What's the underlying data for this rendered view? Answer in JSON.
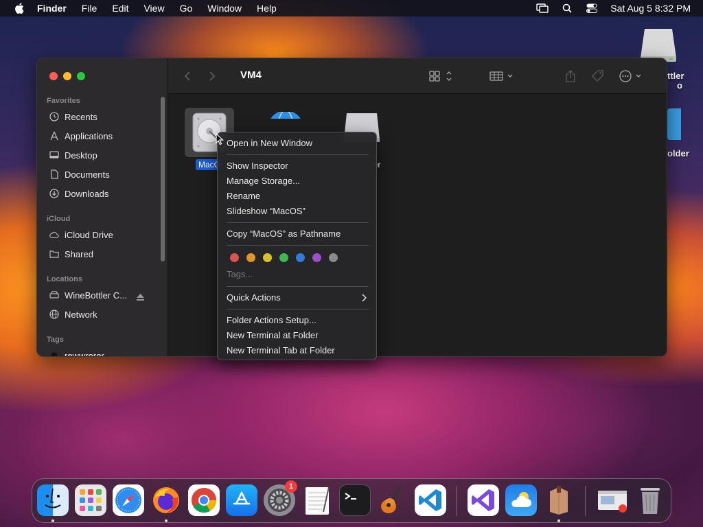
{
  "menubar": {
    "app_name": "Finder",
    "items": [
      "File",
      "Edit",
      "View",
      "Go",
      "Window",
      "Help"
    ],
    "clock": "Sat Aug 5  8:32 PM"
  },
  "desktop": {
    "icon1_label_line1": "ttler",
    "icon1_label_line2": "o",
    "icon2_label": "older"
  },
  "finder": {
    "title": "VM4",
    "sidebar": {
      "favorites_header": "Favorites",
      "favorites": [
        "Recents",
        "Applications",
        "Desktop",
        "Documents",
        "Downloads"
      ],
      "icloud_header": "iCloud",
      "icloud": [
        "iCloud Drive",
        "Shared"
      ],
      "locations_header": "Locations",
      "locations": [
        "WineBottler C...",
        "Network"
      ],
      "tags_header": "Tags",
      "tags": [
        "rewwrerer"
      ]
    },
    "files": [
      {
        "label": "MacO"
      },
      {
        "label": ""
      },
      {
        "label": "er"
      }
    ]
  },
  "context_menu": {
    "open_new_window": "Open in New Window",
    "show_inspector": "Show Inspector",
    "manage_storage": "Manage Storage...",
    "rename": "Rename",
    "slideshow": "Slideshow “MacOS”",
    "copy_pathname": "Copy “MacOS” as Pathname",
    "tags": "Tags...",
    "quick_actions": "Quick Actions",
    "folder_actions": "Folder Actions Setup...",
    "new_terminal": "New Terminal at Folder",
    "new_terminal_tab": "New Terminal Tab at Folder",
    "tag_colors": [
      "#d9534f",
      "#e0962a",
      "#d8c02a",
      "#3fb950",
      "#2f7bd6",
      "#9b4fc8",
      "#8a8a8a"
    ]
  },
  "dock": {
    "apps": [
      "finder-icon",
      "launchpad-icon",
      "safari-icon",
      "firefox-icon",
      "chrome-icon",
      "app-store-icon",
      "system-settings-icon",
      "textedit-icon",
      "terminal-icon",
      "garageband-icon",
      "vscode-icon",
      "visual-studio-icon",
      "weather-icon",
      "winebottler-icon",
      "preview-icon",
      "trash-icon"
    ],
    "settings_badge": "1"
  }
}
